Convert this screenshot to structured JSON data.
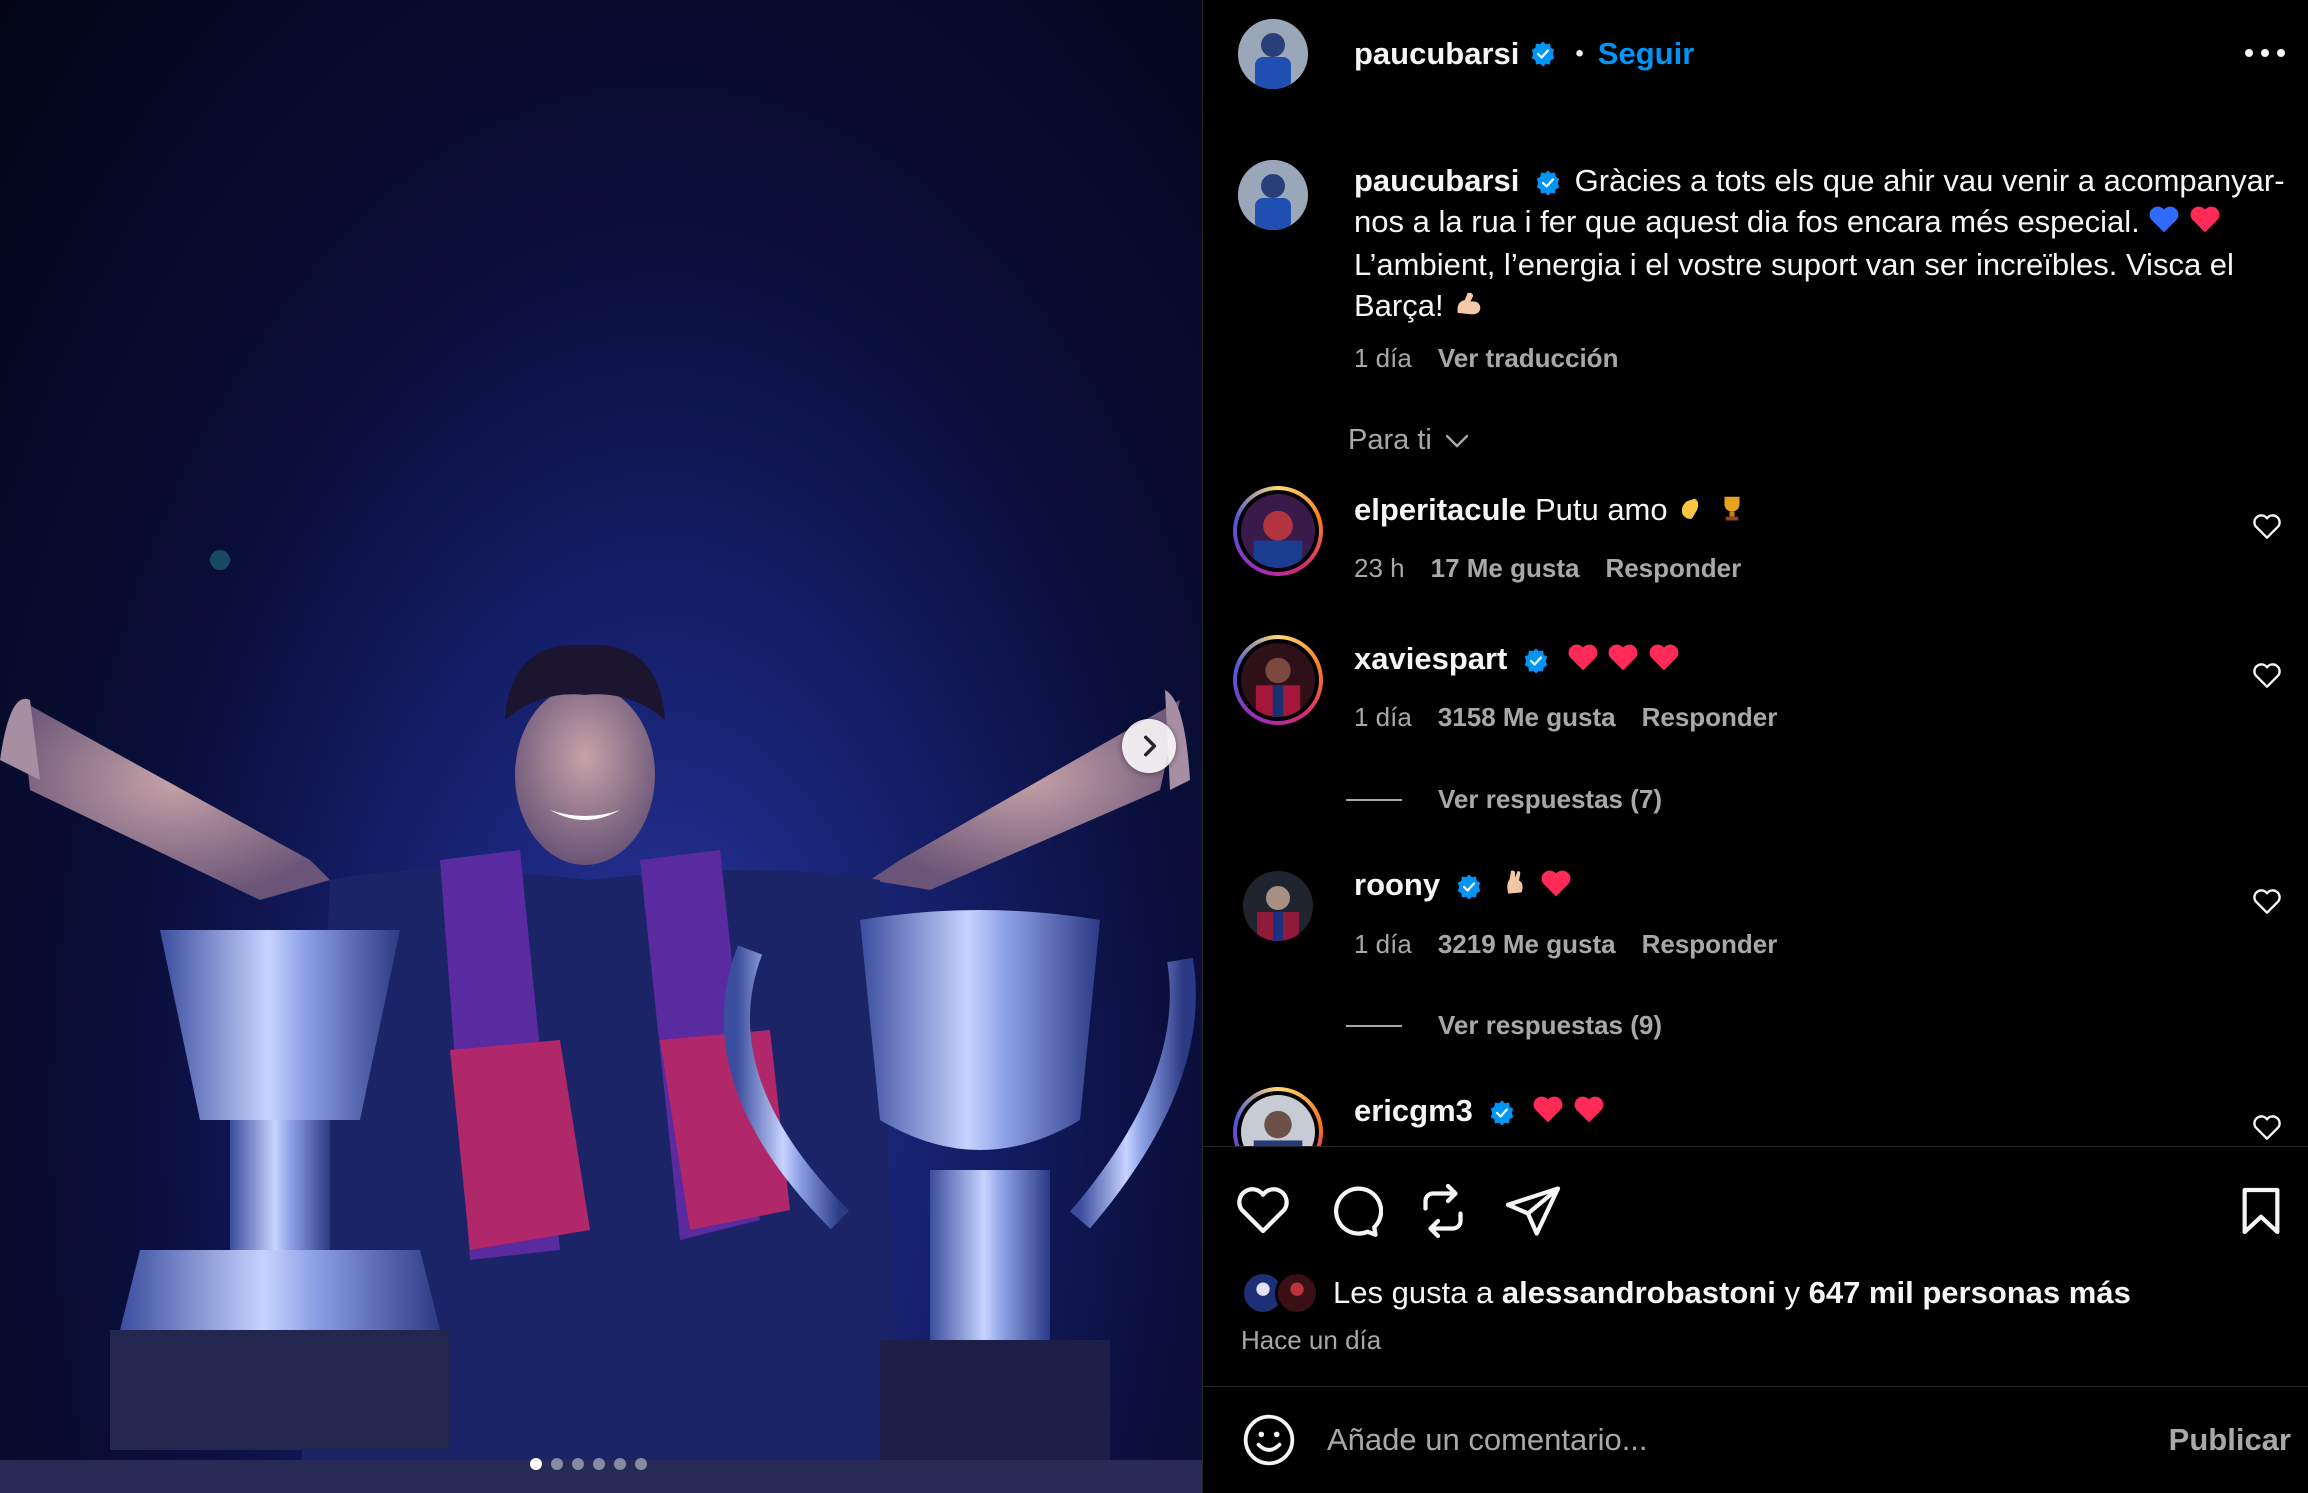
{
  "post": {
    "username": "paucubarsi",
    "follow_label": "Seguir",
    "bullet": "•",
    "caption": "Gràcies a tots els que ahir vau venir a acompanyar-nos a la rua i fer que aquest dia fos encara més especial.",
    "caption_2": "L’ambient, l’energia i el vostre suport van ser increïbles. Visca el Barça!",
    "caption_time": "1 día",
    "translate_label": "Ver traducción"
  },
  "sort": {
    "label": "Para ti"
  },
  "comments": [
    {
      "user": "elperitacule",
      "text": "Putu amo",
      "time": "23 h",
      "likes": "17 Me gusta",
      "reply": "Responder"
    },
    {
      "user": "xaviespart",
      "text": "",
      "time": "1 día",
      "likes": "3158 Me gusta",
      "reply": "Responder",
      "view_replies": "Ver respuestas (7)"
    },
    {
      "user": "roony",
      "text": "",
      "time": "1 día",
      "likes": "3219 Me gusta",
      "reply": "Responder",
      "view_replies": "Ver respuestas (9)"
    },
    {
      "user": "ericgm3",
      "text": ""
    }
  ],
  "likes_line": {
    "prefix": "Les gusta a",
    "user": "alessandrobastoni",
    "joiner": "y",
    "rest": "647 mil personas más"
  },
  "posted_ago": "Hace un día",
  "composer": {
    "placeholder": "Añade un comentario...",
    "publish_label": "Publicar"
  },
  "carousel": {
    "count": 6,
    "active": 0
  },
  "colors": {
    "accent": "#0095f6",
    "verified": "#0095f6",
    "heart": "#ff3040"
  },
  "icons": [
    "more-icon",
    "verified-icon",
    "chevron-down-icon",
    "heart-icon",
    "comment-icon",
    "repost-icon",
    "share-icon",
    "bookmark-icon",
    "emoji-icon",
    "chevron-right-icon"
  ]
}
